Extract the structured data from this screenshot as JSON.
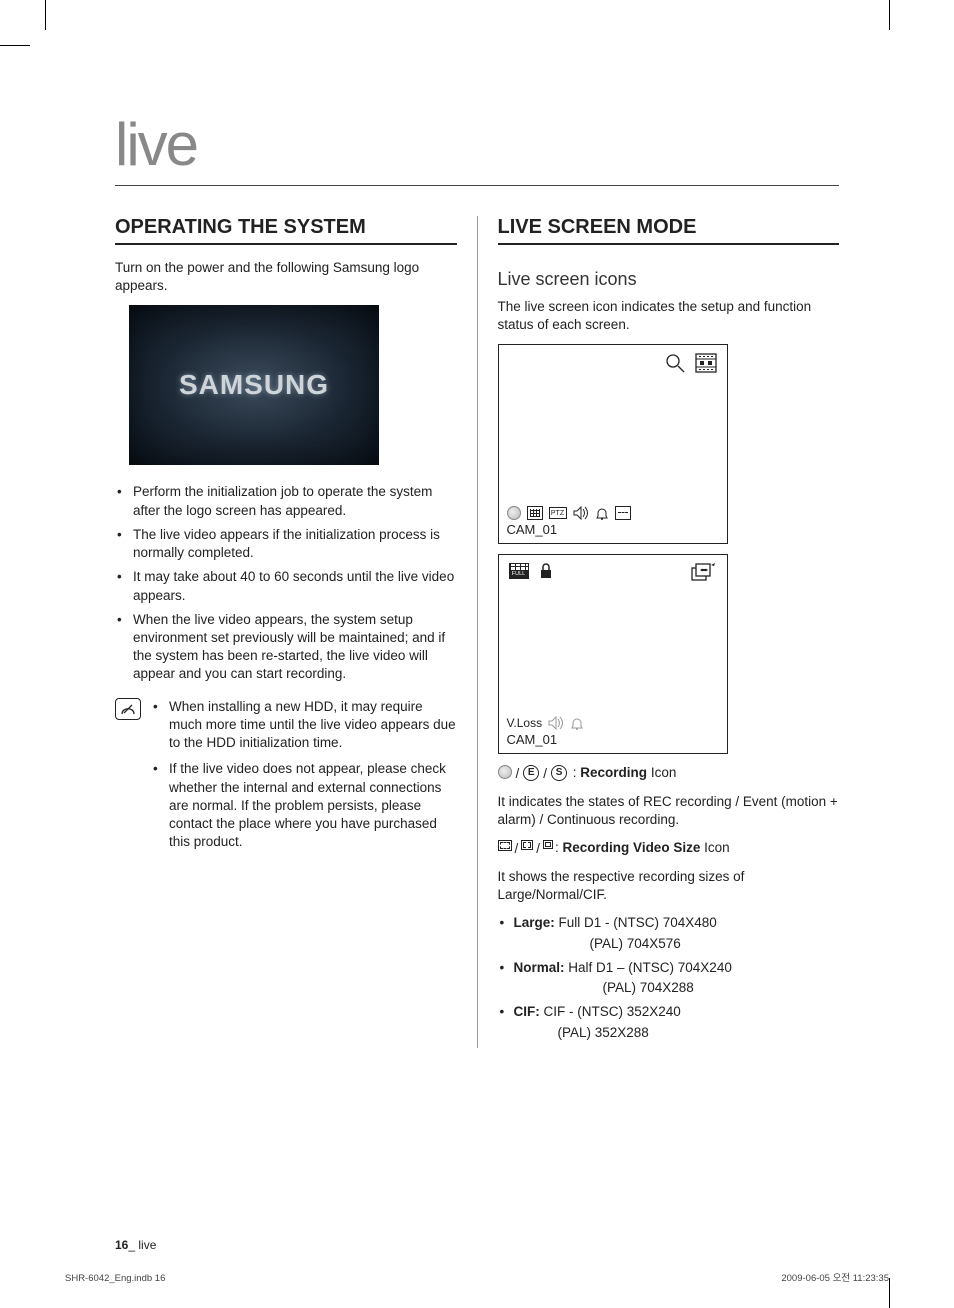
{
  "chapter": "live",
  "left": {
    "heading": "OPERATING THE SYSTEM",
    "intro": "Turn on the power and the following Samsung logo appears.",
    "logo_text": "SAMSUNG",
    "bullets": [
      "Perform the initialization job to operate the system after the logo screen has appeared.",
      "The live video appears if the initialization process is normally completed.",
      "It may take about 40 to 60 seconds until the live video appears.",
      "When the live video appears, the system setup environment set previously will be maintained; and if the system has been re-started, the live video will appear and you can start recording."
    ],
    "notes": [
      "When installing a new HDD, it may require much more time until the live video appears due to the HDD initialization time.",
      "If the live video does not appear, please check whether the internal and external connections are normal. If the problem persists, please contact the place where you have purchased this product."
    ]
  },
  "right": {
    "heading": "LIVE SCREEN MODE",
    "sub": "Live screen icons",
    "sub_desc": "The live screen icon indicates the setup and function status of each screen.",
    "screen1": {
      "rec": "",
      "motion": "",
      "ptz": "PTZ",
      "cam": "CAM_01"
    },
    "screen2": {
      "full": "FULL",
      "vloss": "V.Loss",
      "cam": "CAM_01"
    },
    "rec_label": "Recording",
    "rec_suffix": " Icon",
    "rec_desc": "It indicates the states of REC recording / Event (motion + alarm) / Continuous recording.",
    "size_label": "Recording Video Size",
    "size_suffix": " Icon",
    "size_desc": "It shows the respective recording sizes of Large/Normal/CIF.",
    "sizes": {
      "large_label": "Large:",
      "large_ntsc": " Full D1 - (NTSC) 704X480",
      "large_pal": "(PAL) 704X576",
      "normal_label": "Normal:",
      "normal_ntsc": " Half D1 – (NTSC) 704X240",
      "normal_pal": "(PAL) 704X288",
      "cif_label": "CIF:",
      "cif_ntsc": " CIF - (NTSC) 352X240",
      "cif_pal": "(PAL) 352X288"
    }
  },
  "footer": {
    "page_num": "16",
    "page_sep": "_ ",
    "page_section": "live",
    "file": "SHR-6042_Eng.indb   16",
    "date": "2009-06-05   오전 11:23:35"
  }
}
